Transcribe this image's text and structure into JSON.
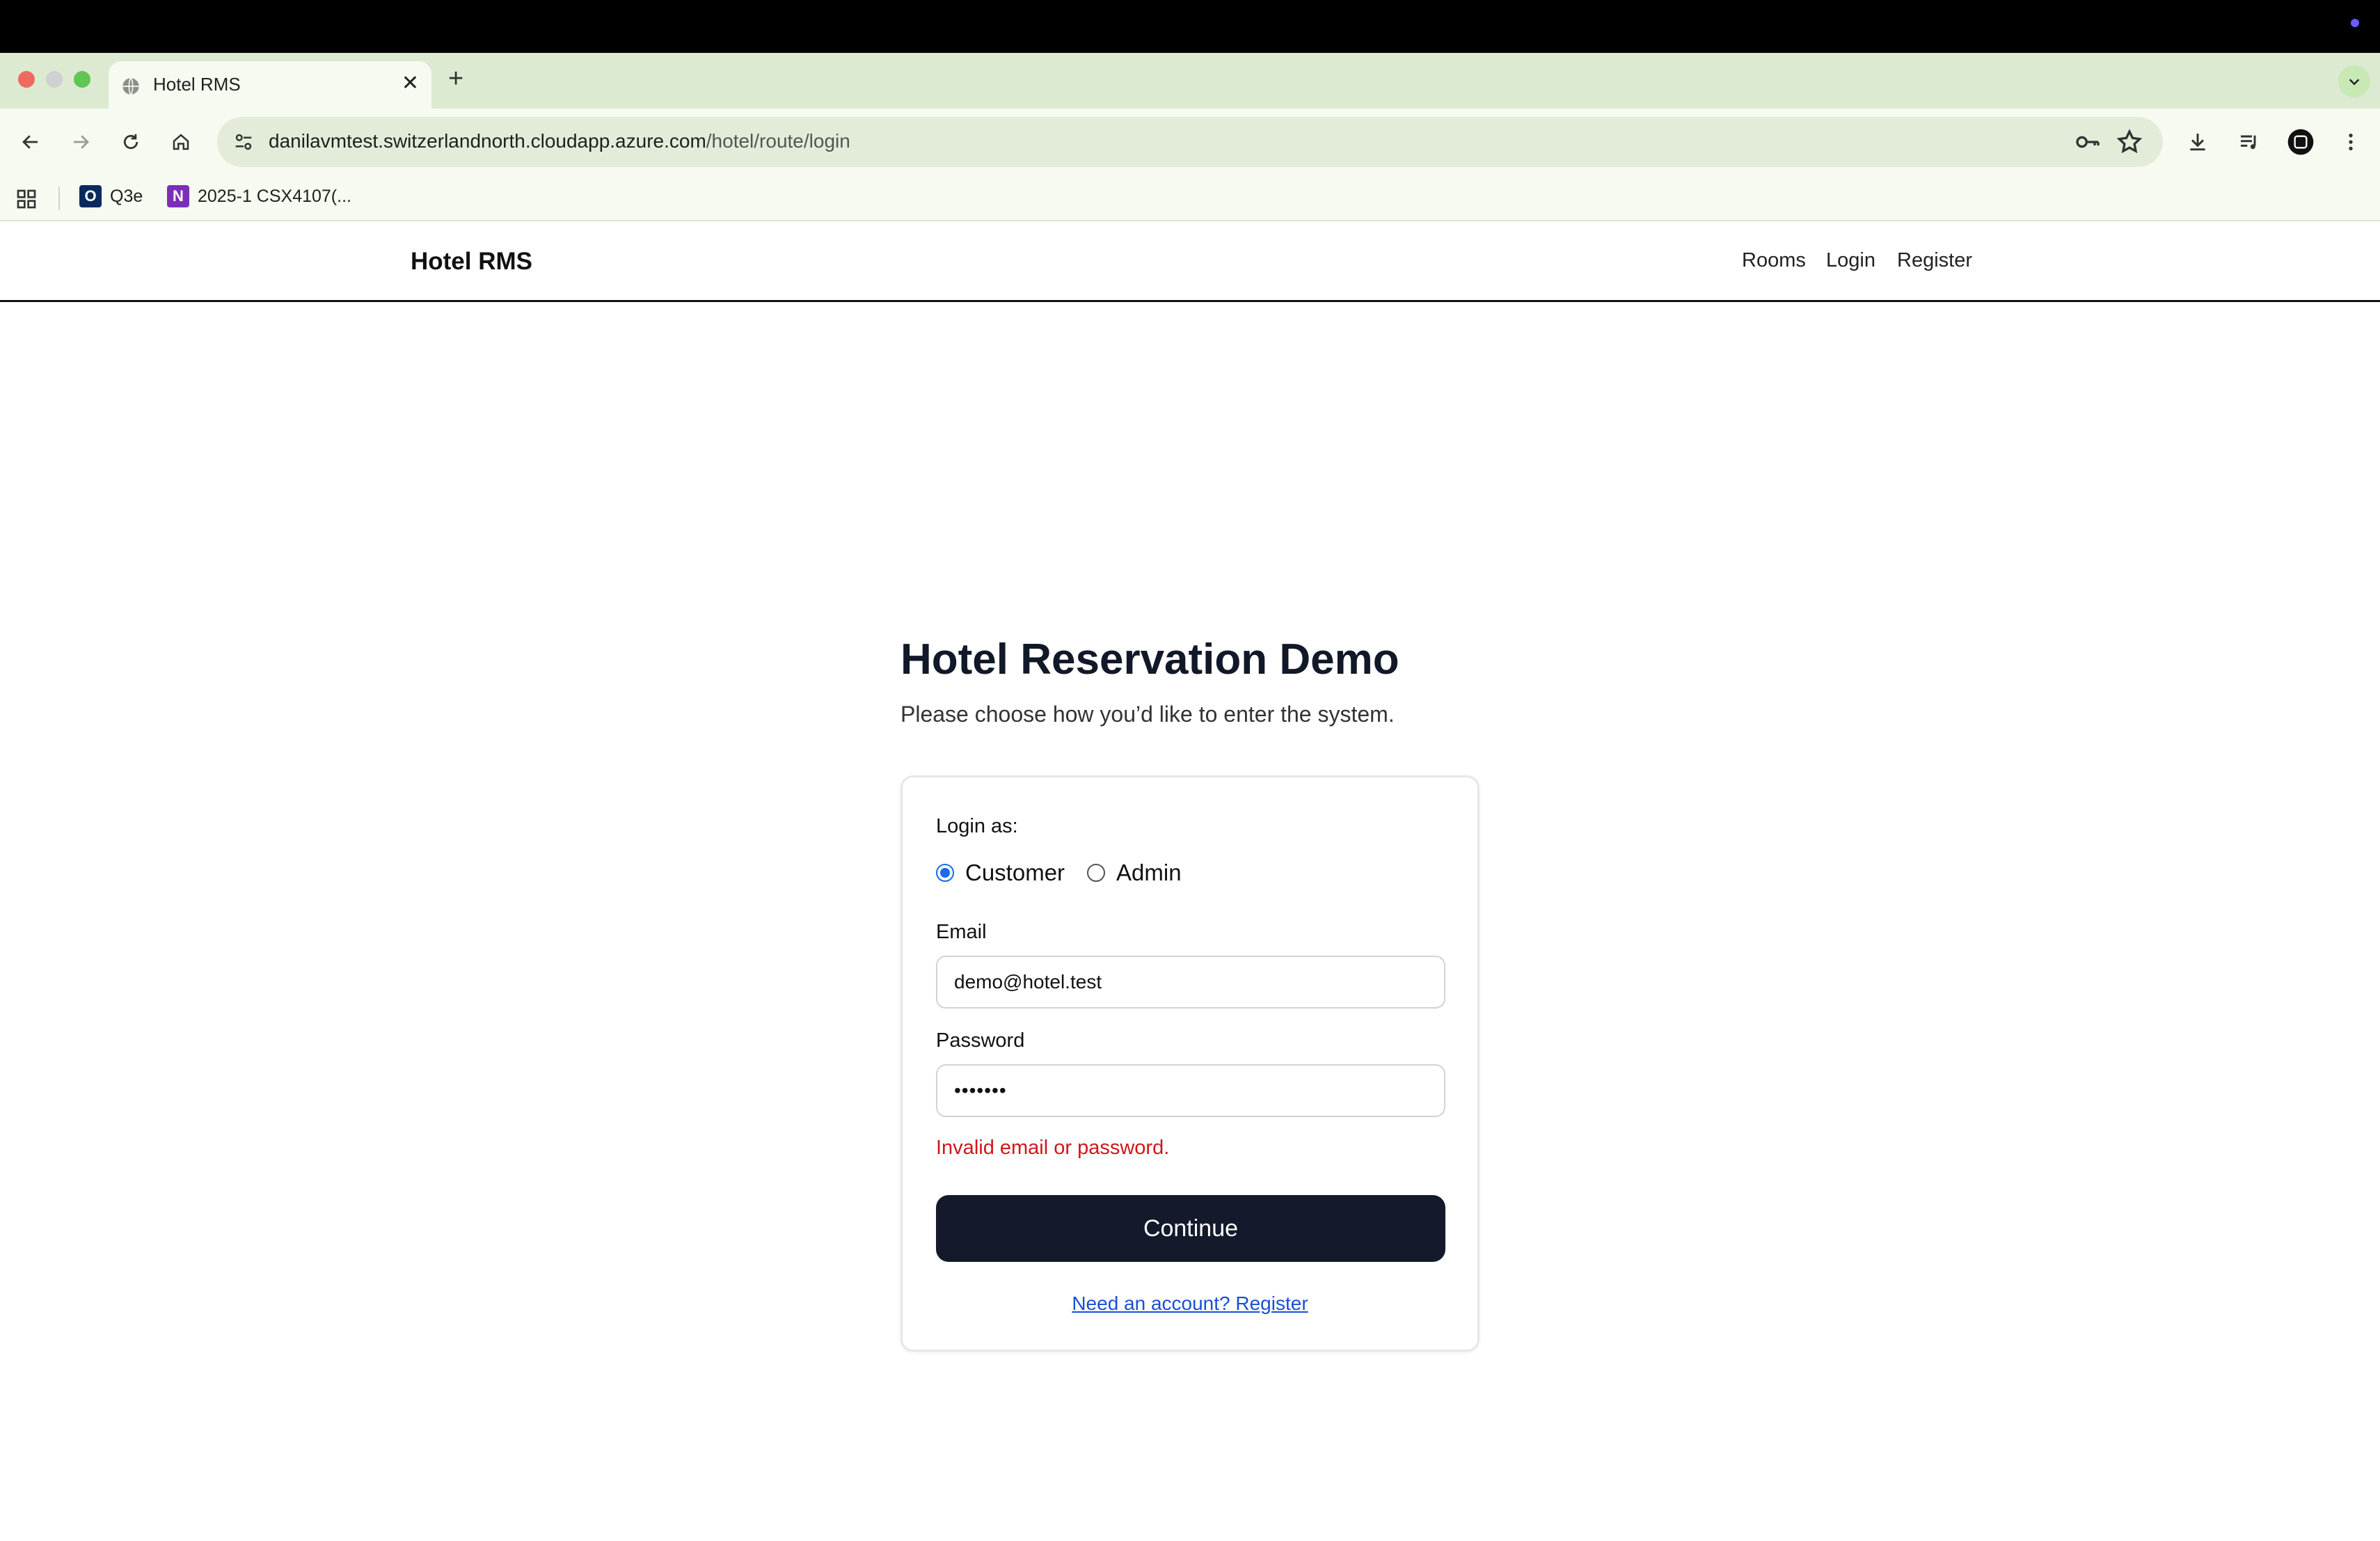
{
  "browser": {
    "tab_title": "Hotel RMS",
    "tab_close": "✕",
    "new_tab": "+",
    "url_host": "danilavmtest.switzerlandnorth.cloudapp.azure.com",
    "url_path": "/hotel/route/login",
    "bookmarks": [
      {
        "label": "Q3e",
        "icon_letter": "O",
        "icon_color": "#0a2a5e"
      },
      {
        "label": "2025-1 CSX4107(...",
        "icon_letter": "N",
        "icon_color": "#7b2fb8"
      }
    ],
    "icons": [
      "back-icon",
      "forward-icon",
      "reload-icon",
      "home-icon",
      "site-info-icon",
      "password-key-icon",
      "bookmark-star-icon",
      "download-icon",
      "media-control-icon",
      "profile-avatar-icon",
      "menu-icon"
    ]
  },
  "site": {
    "brand": "Hotel RMS",
    "nav": {
      "rooms": "Rooms",
      "login": "Login",
      "register": "Register"
    }
  },
  "login": {
    "title": "Hotel Reservation Demo",
    "subtitle": "Please choose how you’d like to enter the system.",
    "login_as_label": "Login as:",
    "roles": [
      {
        "label": "Customer",
        "selected": true
      },
      {
        "label": "Admin",
        "selected": false
      }
    ],
    "email_label": "Email",
    "email_value": "demo@hotel.test",
    "password_label": "Password",
    "password_value": "•••••••",
    "error": "Invalid email or password.",
    "submit": "Continue",
    "register_link": "Need an account? Register"
  },
  "colors": {
    "primary_button": "#141a2c",
    "error": "#d0161b",
    "link": "#1a4fd6",
    "radio_accent": "#1a6ce8"
  }
}
